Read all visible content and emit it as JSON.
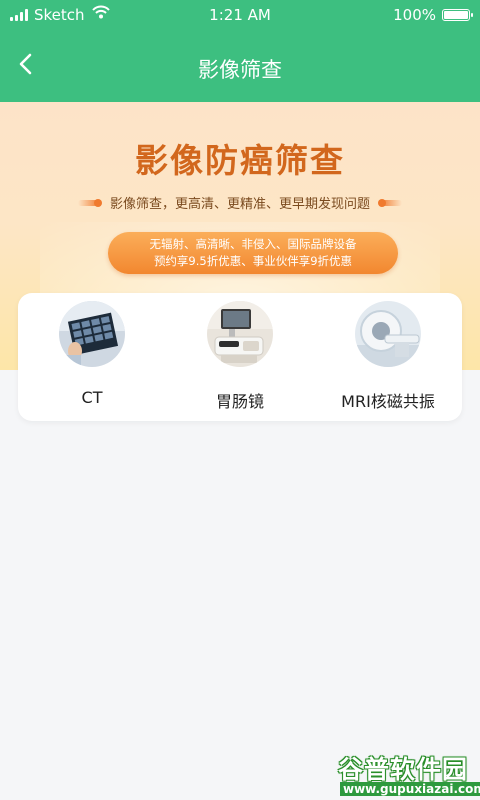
{
  "status_bar": {
    "carrier": "Sketch",
    "time": "1:21 AM",
    "battery": "100%"
  },
  "nav": {
    "title": "影像筛查",
    "back_icon": "chevron-left-icon"
  },
  "banner": {
    "title": "影像防癌筛查",
    "subtitle": "影像筛查，更高清、更精准、更早期发现问题",
    "pill_line1": "无辐射、高清晰、非侵入、国际品牌设备",
    "pill_line2": "预约享9.5折优惠、事业伙伴享9折优惠"
  },
  "services": [
    {
      "label": "CT",
      "icon": "ct-scan-image"
    },
    {
      "label": "胃肠镜",
      "icon": "endoscope-device-image"
    },
    {
      "label": "MRI核磁共振",
      "icon": "mri-machine-image"
    }
  ],
  "watermark": {
    "main": "谷普软件园",
    "url": "www.gupuxiazai.com"
  },
  "colors": {
    "brand_green": "#3dbf80",
    "banner_title": "#d2671d",
    "pill_orange": "#f2872f"
  }
}
